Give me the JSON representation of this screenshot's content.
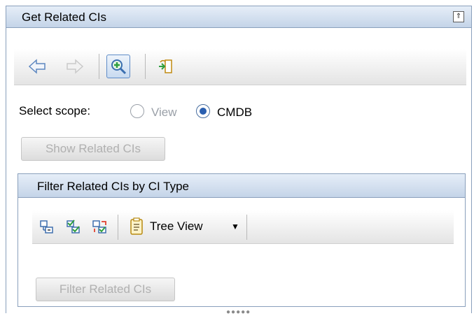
{
  "panel": {
    "title": "Get Related CIs",
    "collapse_icon": "double-chevron-up-icon"
  },
  "toolbar": {
    "icons": [
      "back-arrow-icon",
      "forward-arrow-icon",
      "find-related-icon",
      "export-icon"
    ]
  },
  "scope": {
    "label": "Select scope:",
    "options": [
      {
        "label": "View",
        "selected": false,
        "enabled": false
      },
      {
        "label": "CMDB",
        "selected": true,
        "enabled": true
      }
    ]
  },
  "buttons": {
    "show_related": "Show Related CIs",
    "filter_related": "Filter Related CIs"
  },
  "filter_panel": {
    "title": "Filter Related CIs by CI Type",
    "toolbar": {
      "icons": [
        "collapse-tree-icon",
        "select-all-icon",
        "invert-selection-icon",
        "tree-view-icon"
      ],
      "view_label": "Tree View"
    }
  },
  "colors": {
    "header_gradient_top": "#e6eef8",
    "header_gradient_bottom": "#c4d4e8",
    "border": "#8aa0bc",
    "accent": "#2a5fb0",
    "disabled_text": "#b0b0b0"
  }
}
